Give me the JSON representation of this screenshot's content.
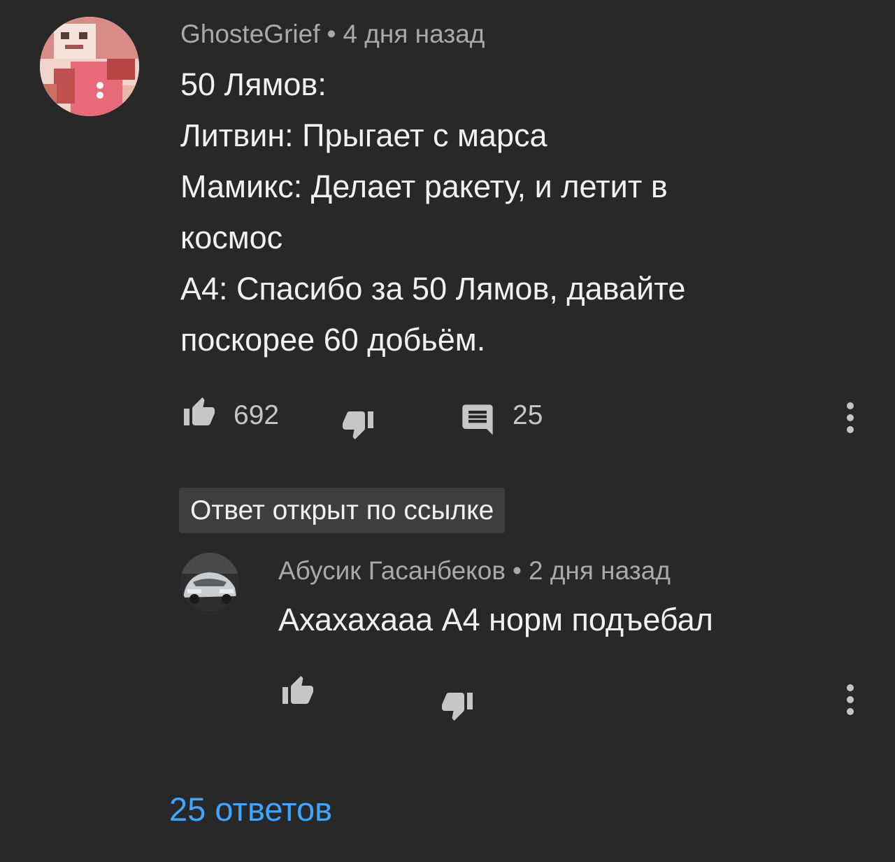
{
  "comment": {
    "author": "GhosteGrief",
    "separator": "•",
    "time": "4 дня назад",
    "lines": [
      "50 Лямов:",
      "Литвин: Прыгает с марса",
      "Мамикс: Делает ракету, и летит в",
      "космос",
      "А4: Спасибо за 50 Лямов, давайте",
      "поскорее 60 добьём."
    ],
    "likes": "692",
    "reply_count": "25",
    "icons": {
      "like": "thumb-up-icon",
      "dislike": "thumb-down-icon",
      "reply": "comment-icon",
      "menu": "more-vert-icon"
    }
  },
  "highlight_chip": "Ответ открыт по ссылке",
  "reply": {
    "author": "Абусик Гасанбеков",
    "separator": "•",
    "time": "2 дня назад",
    "text": "Ахахахааа А4 норм подъебал"
  },
  "view_replies": "25 ответов",
  "colors": {
    "background": "#282828",
    "text_primary": "#f1f1f1",
    "text_secondary": "#a9a9a9",
    "link": "#3ea6ff",
    "chip_bg": "#3e3e3e"
  }
}
